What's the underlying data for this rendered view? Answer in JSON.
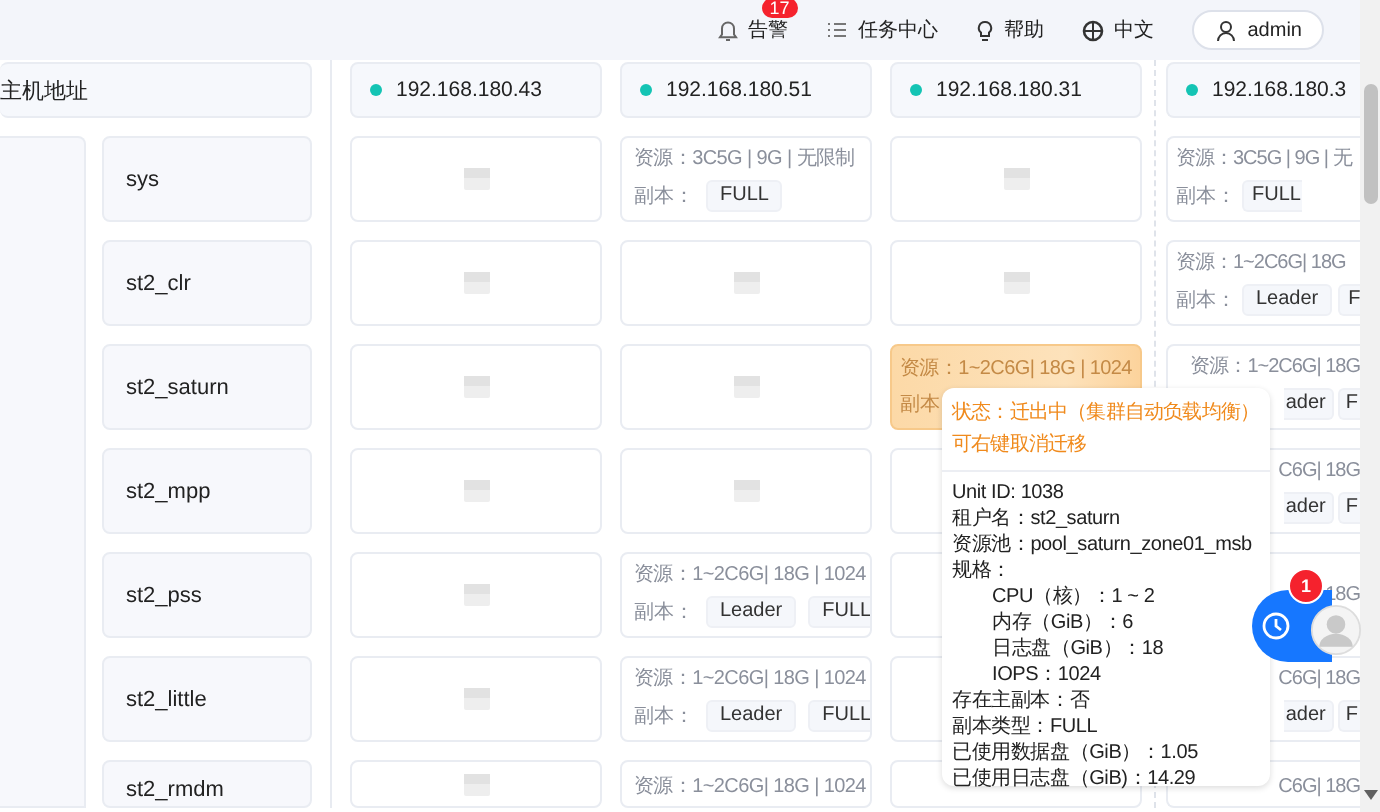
{
  "header": {
    "nav": [
      {
        "kind": "alerts",
        "label": "告警",
        "badge": "17"
      },
      {
        "kind": "tasks",
        "label": "任务中心"
      },
      {
        "kind": "help",
        "label": "帮助"
      },
      {
        "kind": "language",
        "label": "中文"
      }
    ],
    "user": {
      "name": "admin"
    }
  },
  "table": {
    "first_column": "主机地址",
    "hosts": [
      {
        "ip": "192.168.180.43"
      },
      {
        "ip": "192.168.180.51"
      },
      {
        "ip": "192.168.180.31"
      },
      {
        "ip": "192.168.180.3"
      }
    ],
    "rows": [
      {
        "tenant": "sys",
        "cells": [
          {
            "kind": "empty",
            "highlighted": false
          },
          {
            "kind": "unit",
            "highlighted": false,
            "resource": "资源：3C5G | 9G | 无限制",
            "replica_label": "副本：",
            "tags": [
              "FULL"
            ]
          },
          {
            "kind": "empty",
            "highlighted": false
          },
          {
            "kind": "unit",
            "highlighted": false,
            "resource": "资源：3C5G | 9G | 无",
            "replica_label": "副本：",
            "tags": [
              "FULL"
            ]
          }
        ]
      },
      {
        "tenant": "st2_clr",
        "cells": [
          {
            "kind": "empty",
            "highlighted": false
          },
          {
            "kind": "empty",
            "highlighted": false
          },
          {
            "kind": "empty",
            "highlighted": false
          },
          {
            "kind": "unit",
            "highlighted": false,
            "resource": "资源：1~2C6G| 18G",
            "replica_label": "副本：",
            "tags": [
              "Leader",
              "F"
            ]
          }
        ]
      },
      {
        "tenant": "st2_saturn",
        "cells": [
          {
            "kind": "empty",
            "highlighted": false
          },
          {
            "kind": "empty",
            "highlighted": false
          },
          {
            "kind": "unit",
            "highlighted": true,
            "resource": "资源：1~2C6G| 18G | 1024",
            "replica_label": "副本"
          },
          {
            "kind": "clipped",
            "highlighted": false,
            "resource": "资源：1~2C6G| 18G",
            "tags": [
              "ader",
              "F"
            ]
          }
        ]
      },
      {
        "tenant": "st2_mpp",
        "cells": [
          {
            "kind": "empty",
            "highlighted": false
          },
          {
            "kind": "empty",
            "highlighted": false
          },
          {
            "kind": "covered",
            "highlighted": false
          },
          {
            "kind": "clipped",
            "highlighted": false,
            "resource": "C6G| 18G",
            "tags": [
              "ader",
              "F"
            ]
          }
        ]
      },
      {
        "tenant": "st2_pss",
        "cells": [
          {
            "kind": "empty",
            "highlighted": false
          },
          {
            "kind": "unit",
            "highlighted": false,
            "resource": "资源：1~2C6G| 18G | 1024",
            "replica_label": "副本：",
            "tags": [
              "Leader",
              "FULL"
            ]
          },
          {
            "kind": "covered",
            "highlighted": false
          },
          {
            "kind": "clipped",
            "highlighted": false,
            "resource": "18G"
          }
        ]
      },
      {
        "tenant": "st2_little",
        "cells": [
          {
            "kind": "empty",
            "highlighted": false
          },
          {
            "kind": "unit",
            "highlighted": false,
            "resource": "资源：1~2C6G| 18G | 1024",
            "replica_label": "副本：",
            "tags": [
              "Leader",
              "FULL"
            ]
          },
          {
            "kind": "covered",
            "highlighted": false
          },
          {
            "kind": "clipped",
            "highlighted": false,
            "resource": "C6G| 18G",
            "tags": [
              "ader",
              "F"
            ]
          }
        ]
      },
      {
        "tenant": "st2_rmdm",
        "cells": [
          {
            "kind": "empty",
            "highlighted": false
          },
          {
            "kind": "unit",
            "highlighted": false,
            "resource": "资源：1~2C6G| 18G | 1024"
          },
          {
            "kind": "covered",
            "highlighted": false
          },
          {
            "kind": "clipped",
            "highlighted": false,
            "resource": "C6G| 18G"
          }
        ]
      }
    ]
  },
  "tooltip": {
    "title_lines": [
      "状态：迁出中（集群自动负载均衡）",
      "可右键取消迁移"
    ],
    "details": [
      {
        "text": "Unit ID: 1038"
      },
      {
        "text": "租户名：st2_saturn"
      },
      {
        "text": "资源池：pool_saturn_zone01_msb"
      },
      {
        "text": "规格：",
        "children": [
          {
            "text": "CPU（核）：1 ~ 2"
          },
          {
            "text": "内存（GiB）：6"
          },
          {
            "text": "日志盘（GiB）：18"
          },
          {
            "text": "IOPS：1024"
          }
        ]
      },
      {
        "text": "存在主副本：否"
      },
      {
        "text": "副本类型：FULL"
      },
      {
        "text": "已使用数据盘（GiB）：1.05"
      },
      {
        "text": "已使用日志盘（GiB)：14.29"
      }
    ]
  },
  "float_widget": {
    "badge": "1"
  }
}
